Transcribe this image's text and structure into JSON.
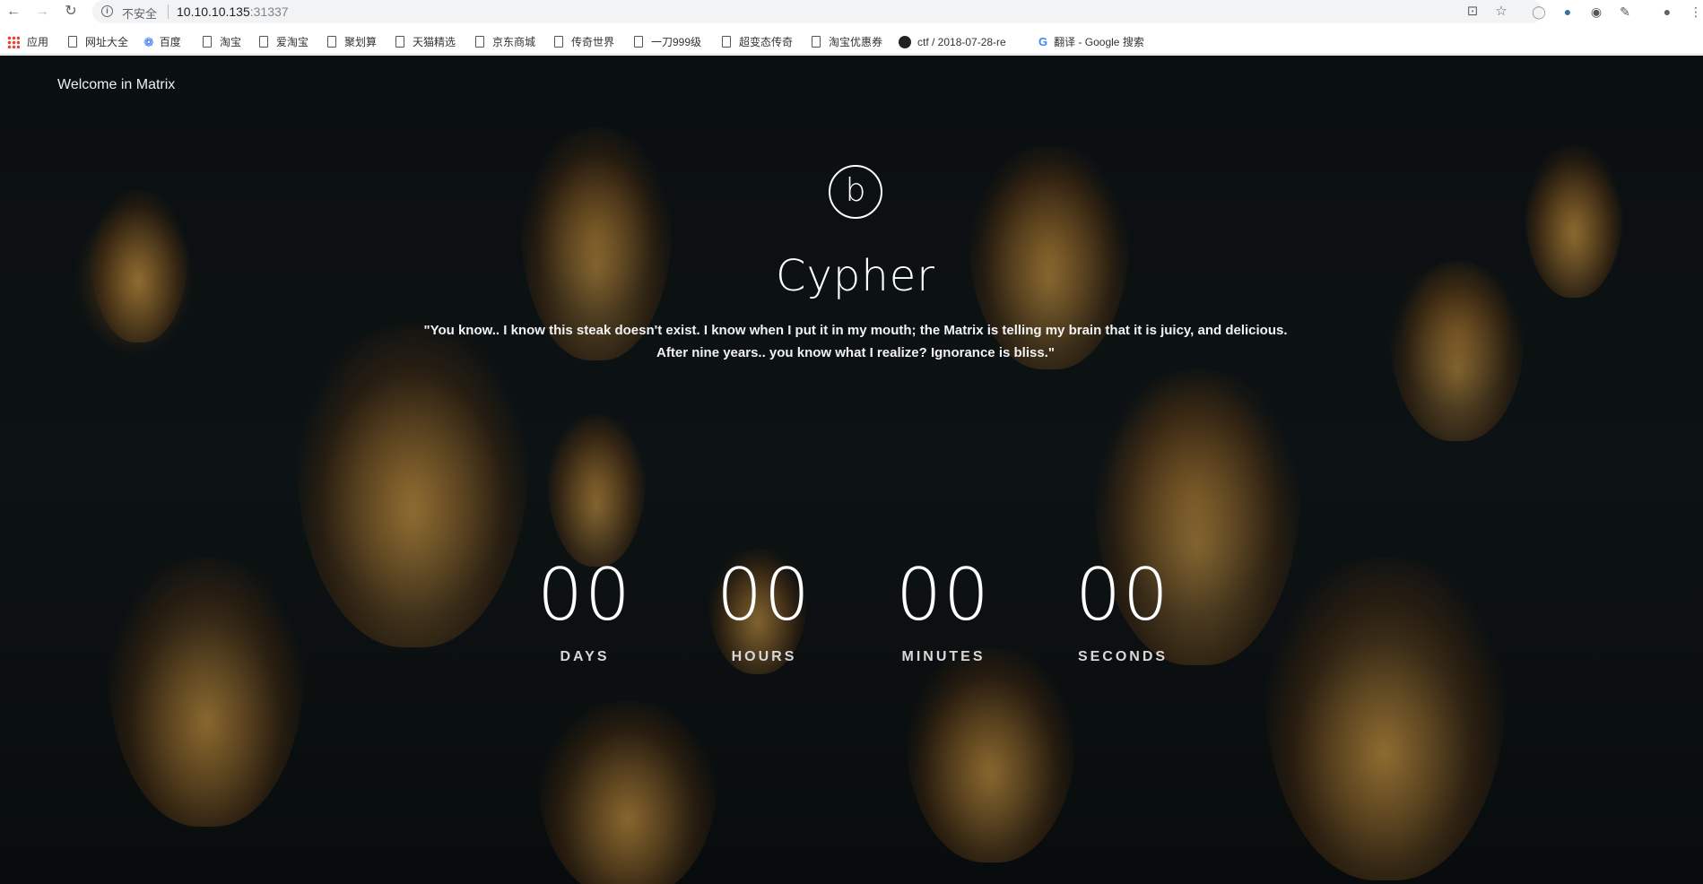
{
  "browser": {
    "nav": {
      "back": "←",
      "forward": "→",
      "reload": "↻"
    },
    "security_label": "不安全",
    "url_host": "10.10.10.135",
    "url_port": ":31337",
    "icons": [
      "translate-icon",
      "star-icon",
      "extension-icon",
      "python-icon",
      "ghost-icon",
      "edit-icon",
      "profile-icon",
      "menu-icon"
    ]
  },
  "bookmarks": [
    {
      "label": "应用",
      "icon": "apps-icon"
    },
    {
      "label": "网址大全",
      "icon": "page-icon"
    },
    {
      "label": "百度",
      "icon": "baidu-icon"
    },
    {
      "label": "淘宝",
      "icon": "page-icon"
    },
    {
      "label": "爱淘宝",
      "icon": "page-icon"
    },
    {
      "label": "聚划算",
      "icon": "page-icon"
    },
    {
      "label": "天猫精选",
      "icon": "page-icon"
    },
    {
      "label": "京东商城",
      "icon": "page-icon"
    },
    {
      "label": "传奇世界",
      "icon": "page-icon"
    },
    {
      "label": "一刀999级",
      "icon": "page-icon"
    },
    {
      "label": "超变态传奇",
      "icon": "page-icon"
    },
    {
      "label": "淘宝优惠券",
      "icon": "page-icon"
    },
    {
      "label": "ctf / 2018-07-28-re",
      "icon": "github-icon"
    },
    {
      "label": "翻译 - Google 搜索",
      "icon": "google-icon"
    }
  ],
  "page": {
    "welcome": "Welcome in Matrix",
    "logo_letter": "b",
    "title": "Cypher",
    "quote_line1": "\"You know.. I know this steak doesn't exist. I know when I put it in my mouth; the Matrix is telling my brain that it is juicy, and delicious.",
    "quote_line2": "After nine years.. you know what I realize? Ignorance is bliss.\"",
    "countdown": [
      {
        "value": "00",
        "label": "DAYS"
      },
      {
        "value": "00",
        "label": "HOURS"
      },
      {
        "value": "00",
        "label": "MINUTES"
      },
      {
        "value": "00",
        "label": "SECONDS"
      }
    ]
  }
}
